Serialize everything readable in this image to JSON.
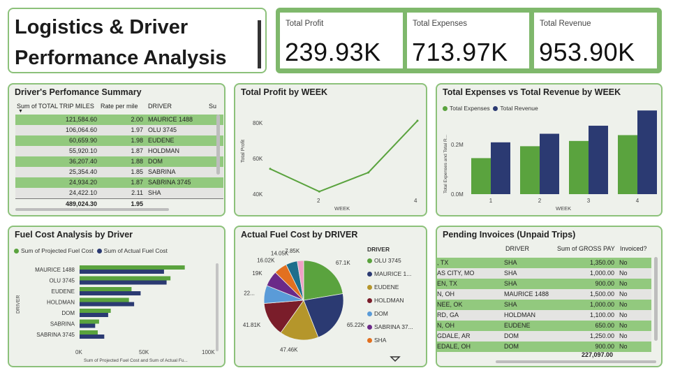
{
  "header": {
    "title_line1": "Logistics & Driver",
    "title_line2": "Performance Analysis"
  },
  "kpis": [
    {
      "label": "Total Profit",
      "value": "239.93K"
    },
    {
      "label": "Total Expenses",
      "value": "713.97K"
    },
    {
      "label": "Total Revenue",
      "value": "953.90K"
    }
  ],
  "driver_summary": {
    "title": "Driver's Perfomance Summary",
    "columns": [
      "Sum of TOTAL TRIP MILES",
      "Rate per mile",
      "DRIVER",
      "Su"
    ],
    "rows": [
      [
        "121,584.60",
        "2.00",
        "MAURICE 1488"
      ],
      [
        "106,064.60",
        "1.97",
        "OLU 3745"
      ],
      [
        "60,659.90",
        "1.98",
        "EUDENE"
      ],
      [
        "55,920.10",
        "1.87",
        "HOLDMAN"
      ],
      [
        "36,207.40",
        "1.88",
        "DOM"
      ],
      [
        "25,354.40",
        "1.85",
        "SABRINA"
      ],
      [
        "24,934.20",
        "1.87",
        "SABRINA 3745"
      ],
      [
        "24,422.10",
        "2.11",
        "SHA"
      ]
    ],
    "total": [
      "489,024.30",
      "1.95"
    ]
  },
  "profit_chart": {
    "title": "Total Profit by WEEK",
    "xlabel": "WEEK",
    "ylabel": "Total Profit",
    "ytick_labels": [
      "80K",
      "60K",
      "40K"
    ],
    "xtick_labels": [
      "2",
      "4"
    ]
  },
  "expense_chart": {
    "title": "Total Expenses vs Total Revenue by WEEK",
    "xlabel": "WEEK",
    "ylabel": "Total Expenses and Total R...",
    "ytick_labels": [
      "0.2M",
      "0.0M"
    ],
    "legend": [
      "Total Expenses",
      "Total Revenue"
    ]
  },
  "fuel_chart": {
    "title": "Fuel Cost Analysis by Driver",
    "legend": [
      "Sum of Projected Fuel Cost",
      "Sum of Actual Fuel Cost"
    ],
    "xlabel": "Sum of Projected Fuel Cost and Sum of Actual Fu...",
    "ylabel": "DRIVER",
    "xtick_labels": [
      "0K",
      "50K",
      "100K"
    ]
  },
  "pie_chart": {
    "title": "Actual Fuel Cost by DRIVER",
    "legend_title": "DRIVER",
    "legend_items": [
      "OLU 3745",
      "MAURICE 1...",
      "EUDENE",
      "HOLDMAN",
      "DOM",
      "SABRINA 37...",
      "SHA"
    ]
  },
  "invoices": {
    "title": "Pending Invoices (Unpaid Trips)",
    "columns": [
      "DRIVER",
      "Sum of GROSS PAY",
      "Invoiced?"
    ],
    "rows": [
      [
        ", TX",
        "SHA",
        "1,350.00",
        "No"
      ],
      [
        "AS CITY, MO",
        "SHA",
        "1,000.00",
        "No"
      ],
      [
        "EN, TX",
        "SHA",
        "900.00",
        "No"
      ],
      [
        "N, OH",
        "MAURICE 1488",
        "1,500.00",
        "No"
      ],
      [
        "NEE, OK",
        "SHA",
        "1,000.00",
        "No"
      ],
      [
        "RD, GA",
        "HOLDMAN",
        "1,100.00",
        "No"
      ],
      [
        "N, OH",
        "EUDENE",
        "650.00",
        "No"
      ],
      [
        "GDALE, AR",
        "DOM",
        "1,250.00",
        "No"
      ],
      [
        "EDALE, OH",
        "DOM",
        "900.00",
        "No"
      ]
    ],
    "total": "227,097.00"
  },
  "colors": {
    "green": "#5aa33e",
    "navy": "#2b3a72",
    "row_green": "#92c97e",
    "border": "#8cc17a"
  },
  "chart_data": [
    {
      "type": "line",
      "title": "Total Profit by WEEK",
      "xlabel": "WEEK",
      "ylabel": "Total Profit",
      "x": [
        1,
        2,
        3,
        4
      ],
      "series": [
        {
          "name": "Total Profit",
          "values": [
            57000,
            44500,
            55000,
            83500
          ]
        }
      ],
      "ylim": [
        40000,
        90000
      ],
      "grid": false
    },
    {
      "type": "bar",
      "title": "Total Expenses vs Total Revenue by WEEK",
      "xlabel": "WEEK",
      "ylabel": "Total Expenses and Total R...",
      "categories": [
        "1",
        "2",
        "3",
        "4"
      ],
      "series": [
        {
          "name": "Total Expenses",
          "values": [
            130000,
            173000,
            192000,
            213000
          ]
        },
        {
          "name": "Total Revenue",
          "values": [
            187000,
            218000,
            247000,
            302000
          ]
        }
      ],
      "ylim": [
        0,
        300000
      ],
      "legend": "top-left"
    },
    {
      "type": "bar",
      "orientation": "horizontal",
      "title": "Fuel Cost Analysis by Driver",
      "categories": [
        "MAURICE 1488",
        "OLU 3745",
        "EUDENE",
        "HOLDMAN",
        "DOM",
        "SABRINA",
        "SABRINA 3745"
      ],
      "series": [
        {
          "name": "Sum of Projected Fuel Cost",
          "values": [
            81000,
            70000,
            40000,
            38000,
            24000,
            15000,
            14000
          ]
        },
        {
          "name": "Sum of Actual Fuel Cost",
          "values": [
            65000,
            67000,
            47000,
            42000,
            22000,
            12000,
            19000
          ]
        }
      ],
      "xlim": [
        0,
        100000
      ],
      "legend": "top-left"
    },
    {
      "type": "pie",
      "title": "Actual Fuel Cost by DRIVER",
      "labels": [
        "OLU 3745",
        "MAURICE 1...",
        "EUDENE",
        "HOLDMAN",
        "DOM",
        "SABRINA 37...",
        "SHA",
        "",
        ""
      ],
      "values": [
        67100,
        65220,
        47460,
        41810,
        22000,
        19000,
        16020,
        14050,
        7850
      ],
      "data_labels": [
        "67.1K",
        "65.22K",
        "47.46K",
        "41.81K",
        "22...",
        "19K",
        "16.02K",
        "14.05K",
        "7.85K"
      ],
      "legend": "right"
    }
  ]
}
